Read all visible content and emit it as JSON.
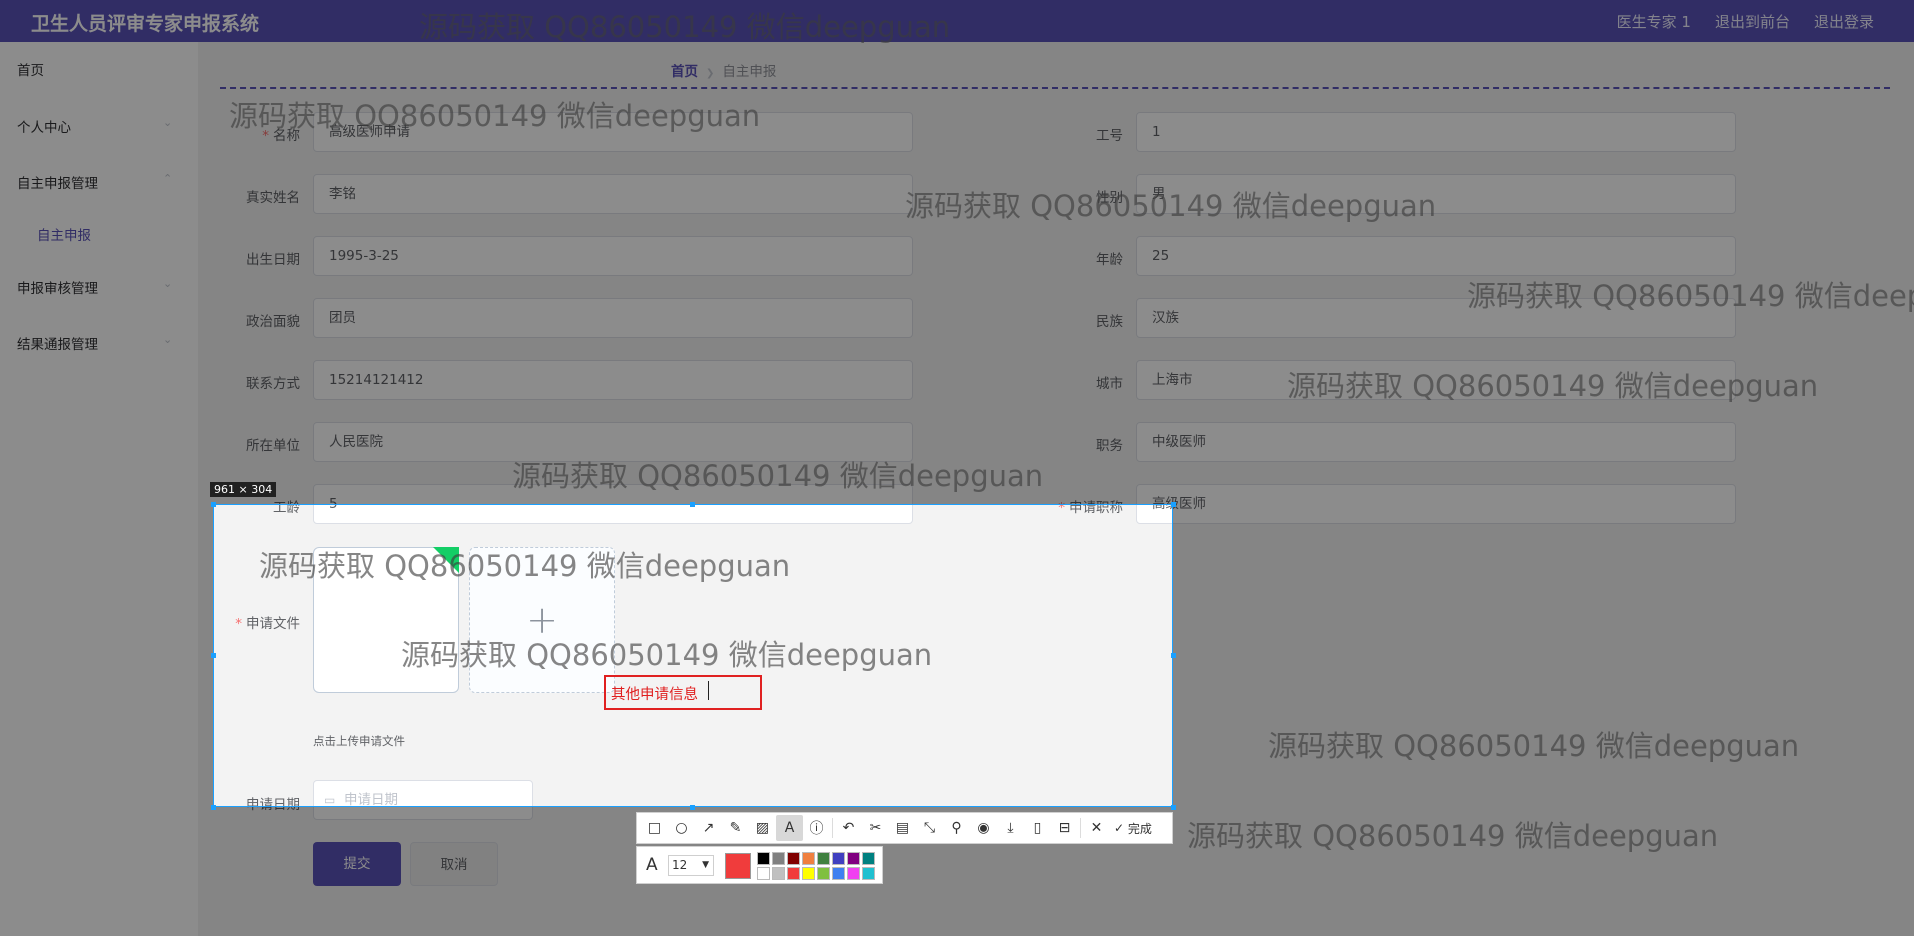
{
  "header": {
    "app_title": "卫生人员评审专家申报系统",
    "user_label": "医生专家 1",
    "link_frontend": "退出到前台",
    "link_logout": "退出登录"
  },
  "sidebar": {
    "home": "首页",
    "personal_center": "个人中心",
    "self_declare_manage": "自主申报管理",
    "self_declare": "自主申报",
    "review_manage": "申报审核管理",
    "result_manage": "结果通报管理"
  },
  "breadcrumb": {
    "home": "首页",
    "current": "自主申报"
  },
  "form": {
    "name_label": "名称",
    "name_value": "高级医师申请",
    "job_no_label": "工号",
    "job_no_value": "1",
    "realname_label": "真实姓名",
    "realname_value": "李铭",
    "gender_label": "性别",
    "gender_value": "男",
    "birth_label": "出生日期",
    "birth_value": "1995-3-25",
    "age_label": "年龄",
    "age_value": "25",
    "politics_label": "政治面貌",
    "politics_value": "团员",
    "nation_label": "民族",
    "nation_value": "汉族",
    "contact_label": "联系方式",
    "contact_value": "15214121412",
    "city_label": "城市",
    "city_value": "上海市",
    "unit_label": "所在单位",
    "unit_value": "人民医院",
    "post_label": "职务",
    "post_value": "中级医师",
    "seniority_label": "工龄",
    "seniority_value": "5",
    "title_label": "申请职称",
    "title_value": "高级医师",
    "file_label": "申请文件",
    "upload_tip": "点击上传申请文件",
    "date_label": "申请日期",
    "date_placeholder": "申请日期",
    "submit": "提交",
    "cancel": "取消"
  },
  "screenshot_tool": {
    "size": "961 × 304",
    "annotation": "其他申请信息",
    "finish": "完成",
    "font_size": "12",
    "current_color": "#f03c3c",
    "palette": [
      "#000000",
      "#808080",
      "#800000",
      "#f08040",
      "#408040",
      "#4040c0",
      "#800080",
      "#008080",
      "#ffffff",
      "#c0c0c0",
      "#f03c3c",
      "#ffff00",
      "#80c040",
      "#4080f0",
      "#f040f0",
      "#20c0d0"
    ]
  },
  "watermark": "源码获取 QQ86050149 微信deepguan"
}
